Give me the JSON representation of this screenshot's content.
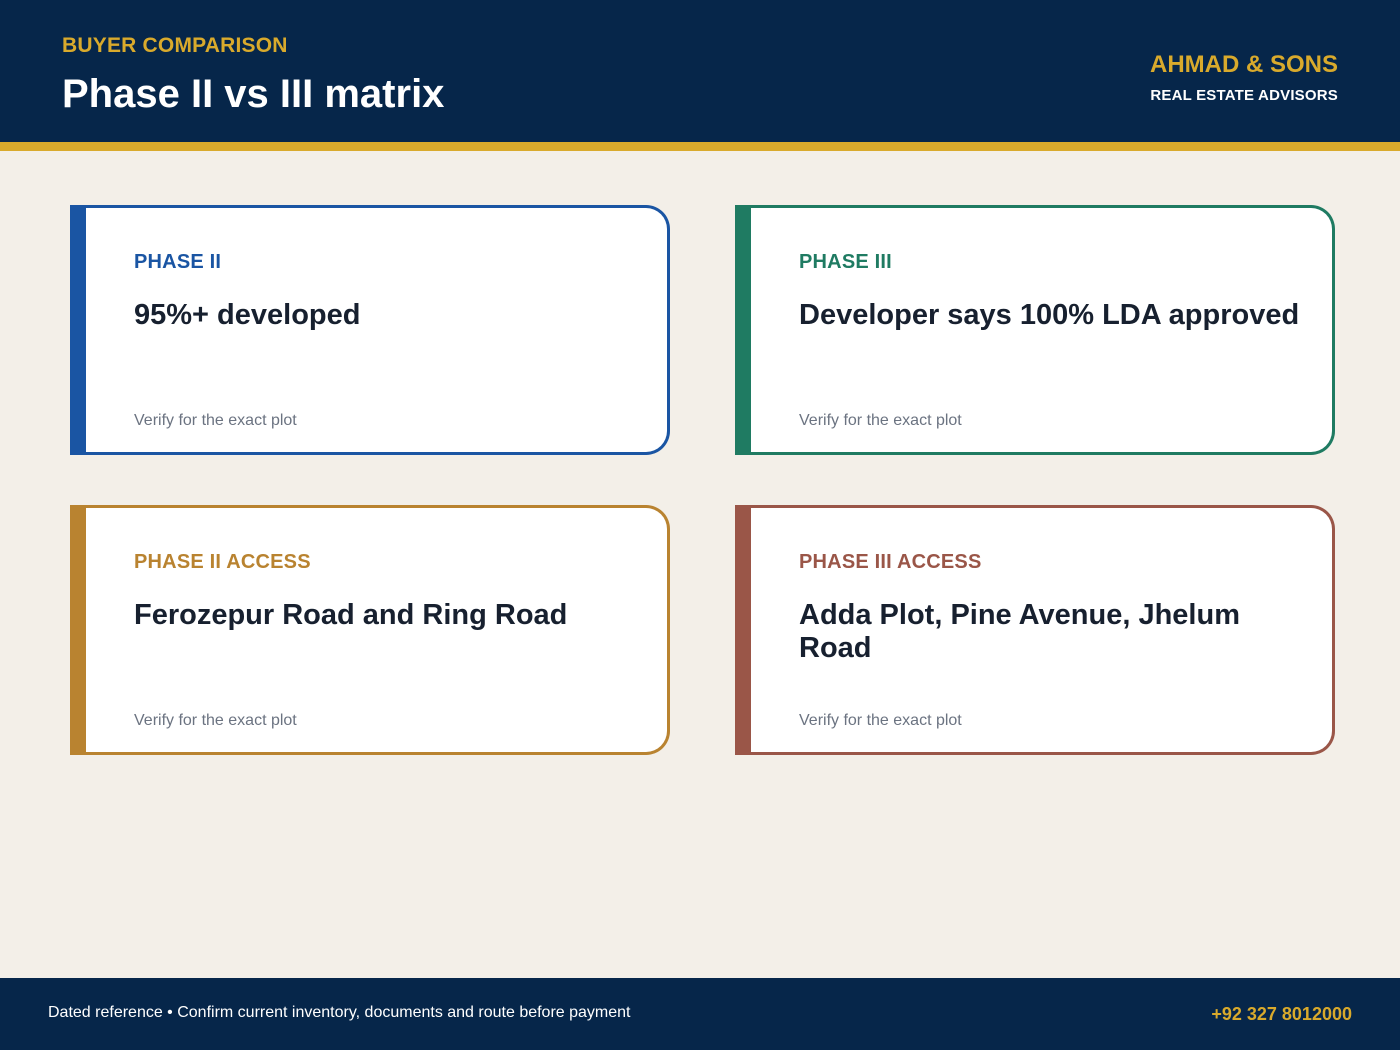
{
  "header": {
    "eyebrow": "BUYER COMPARISON",
    "title": "Phase II vs III matrix",
    "brand_name": "AHMAD & SONS",
    "brand_sub": "REAL ESTATE ADVISORS"
  },
  "cards": [
    {
      "label": "PHASE II",
      "value": "95%+ developed",
      "note": "Verify for the exact plot",
      "color": "#1a55a3"
    },
    {
      "label": "PHASE III",
      "value": "Developer says 100% LDA approved",
      "note": "Verify for the exact plot",
      "color": "#1f7b62"
    },
    {
      "label": "PHASE II ACCESS",
      "value": "Ferozepur Road and Ring Road",
      "note": "Verify for the exact plot",
      "color": "#b98330"
    },
    {
      "label": "PHASE III ACCESS",
      "value": "Adda Plot, Pine Avenue, Jhelum Road",
      "note": "Verify for the exact plot",
      "color": "#9a5648"
    }
  ],
  "footer": {
    "note": "Dated reference • Confirm current inventory, documents and route before payment",
    "phone": "+92 327 8012000"
  },
  "colors": {
    "navy": "#06264a",
    "gold_accent": "#d9aa2c",
    "background": "#f3efe8"
  }
}
